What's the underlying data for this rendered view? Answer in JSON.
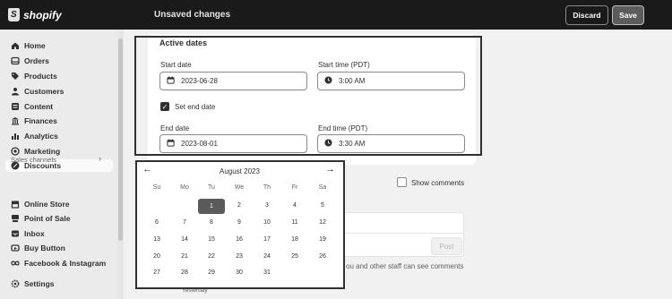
{
  "topbar": {
    "brand": "shopify",
    "status": "Unsaved changes",
    "discard_label": "Discard",
    "save_label": "Save"
  },
  "sidebar": {
    "items": [
      {
        "label": "Home",
        "icon": "home-icon"
      },
      {
        "label": "Orders",
        "icon": "orders-icon"
      },
      {
        "label": "Products",
        "icon": "tag-icon"
      },
      {
        "label": "Customers",
        "icon": "person-icon"
      },
      {
        "label": "Content",
        "icon": "content-icon"
      },
      {
        "label": "Finances",
        "icon": "bank-icon"
      },
      {
        "label": "Analytics",
        "icon": "chart-icon"
      },
      {
        "label": "Marketing",
        "icon": "target-icon"
      },
      {
        "label": "Discounts",
        "icon": "discount-icon"
      }
    ],
    "sales_channels_label": "Sales channels",
    "channels": [
      {
        "label": "Online Store",
        "icon": "store-icon"
      },
      {
        "label": "Point of Sale",
        "icon": "pos-icon"
      },
      {
        "label": "Inbox",
        "icon": "inbox-icon"
      },
      {
        "label": "Buy Button",
        "icon": "buy-button-icon"
      },
      {
        "label": "Facebook & Instagram",
        "icon": "infinity-icon"
      }
    ],
    "settings_label": "Settings"
  },
  "active_dates": {
    "title": "Active dates",
    "start_date_label": "Start date",
    "start_date_value": "2023-06-28",
    "start_time_label": "Start time (PDT)",
    "start_time_value": "3:00 AM",
    "set_end_date_label": "Set end date",
    "set_end_date_checked": true,
    "end_date_label": "End date",
    "end_date_value": "2023-08-01",
    "end_time_label": "End time (PDT)",
    "end_time_value": "3:30 AM"
  },
  "timeline": {
    "show_comments_label": "Show comments",
    "post_label": "Post",
    "staff_note": "ou and other staff can see comments",
    "yesterday": "Yesterday"
  },
  "datepicker": {
    "month": "August 2023",
    "weekdays": [
      "Su",
      "Mo",
      "Tu",
      "We",
      "Th",
      "Fr",
      "Sa"
    ],
    "selected_day": 1,
    "weeks": [
      [
        "",
        "",
        "1",
        "2",
        "3",
        "4",
        "5"
      ],
      [
        "6",
        "7",
        "8",
        "9",
        "10",
        "11",
        "12"
      ],
      [
        "13",
        "14",
        "15",
        "16",
        "17",
        "18",
        "19"
      ],
      [
        "20",
        "21",
        "22",
        "23",
        "24",
        "25",
        "26"
      ],
      [
        "27",
        "28",
        "29",
        "30",
        "31",
        "",
        ""
      ]
    ]
  },
  "colors": {
    "topbar": "#1a1a1a",
    "sidebar": "#ebebeb",
    "selected_day": "#5a5a5a",
    "highlight_border": "#303030"
  }
}
